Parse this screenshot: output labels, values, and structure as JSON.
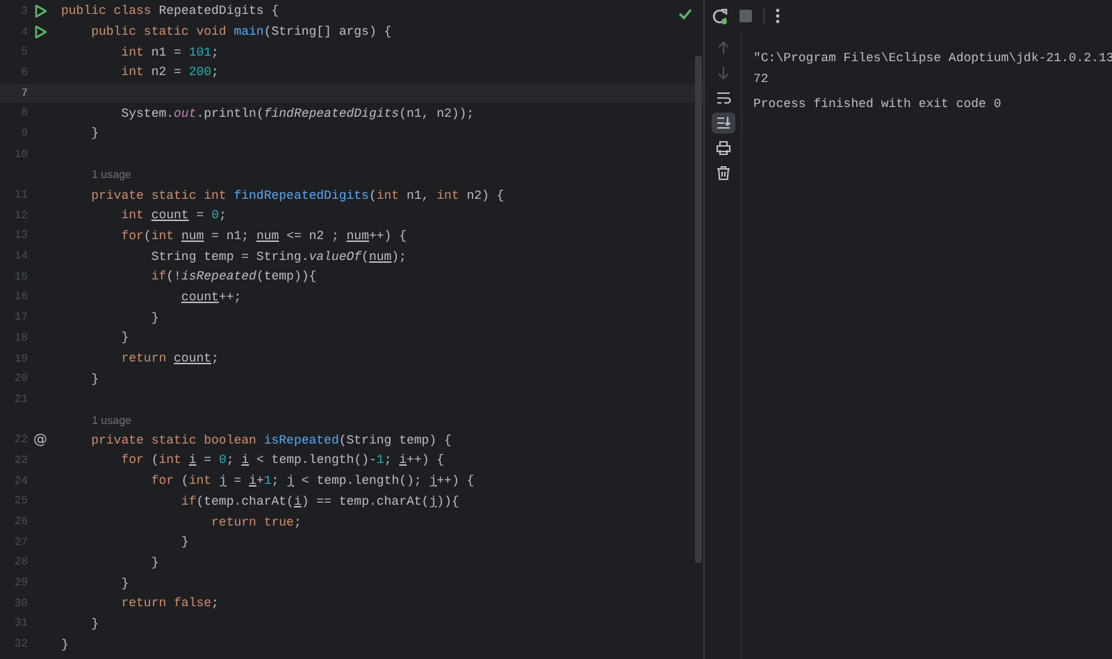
{
  "editor": {
    "lines": [
      {
        "kind": "code",
        "number": "3",
        "gutter": {
          "kind": "run"
        },
        "current": false,
        "tokens": [
          {
            "text": "public class ",
            "kind": "keyword"
          },
          {
            "text": "RepeatedDigits {",
            "kind": "plain"
          }
        ]
      },
      {
        "kind": "code",
        "number": "4",
        "gutter": {
          "kind": "run"
        },
        "current": false,
        "tokens": [
          {
            "text": "    public static void ",
            "kind": "keyword"
          },
          {
            "text": "main",
            "kind": "method"
          },
          {
            "text": "(String[] args) {",
            "kind": "plain"
          }
        ]
      },
      {
        "kind": "code",
        "number": "5",
        "current": false,
        "tokens": [
          {
            "text": "        int ",
            "kind": "keyword"
          },
          {
            "text": "n1 = ",
            "kind": "plain"
          },
          {
            "text": "101",
            "kind": "number"
          },
          {
            "text": ";",
            "kind": "plain"
          }
        ]
      },
      {
        "kind": "code",
        "number": "6",
        "current": false,
        "tokens": [
          {
            "text": "        int ",
            "kind": "keyword"
          },
          {
            "text": "n2 = ",
            "kind": "plain"
          },
          {
            "text": "200",
            "kind": "number"
          },
          {
            "text": ";",
            "kind": "plain"
          }
        ]
      },
      {
        "kind": "code",
        "number": "7",
        "current": true
      },
      {
        "kind": "code",
        "number": "8",
        "current": false,
        "tokens": [
          {
            "text": "        System.",
            "kind": "plain"
          },
          {
            "text": "out",
            "kind": "field"
          },
          {
            "text": ".println(",
            "kind": "plain"
          },
          {
            "text": "findRepeatedDigits",
            "kind": "static"
          },
          {
            "text": "(n1, n2));",
            "kind": "plain"
          }
        ]
      },
      {
        "kind": "code",
        "number": "9",
        "current": false,
        "tokens": [
          {
            "text": "    }",
            "kind": "plain"
          }
        ]
      },
      {
        "kind": "code",
        "number": "10",
        "current": false
      },
      {
        "kind": "hint",
        "text": "1 usage"
      },
      {
        "kind": "code",
        "number": "11",
        "current": false,
        "tokens": [
          {
            "text": "    private static int ",
            "kind": "keyword"
          },
          {
            "text": "findRepeatedDigits",
            "kind": "method"
          },
          {
            "text": "(",
            "kind": "plain"
          },
          {
            "text": "int ",
            "kind": "keyword"
          },
          {
            "text": "n1, ",
            "kind": "plain"
          },
          {
            "text": "int ",
            "kind": "keyword"
          },
          {
            "text": "n2) {",
            "kind": "plain"
          }
        ]
      },
      {
        "kind": "code",
        "number": "12",
        "current": false,
        "tokens": [
          {
            "text": "        int ",
            "kind": "keyword"
          },
          {
            "text": "count",
            "kind": "variable"
          },
          {
            "text": " = ",
            "kind": "plain"
          },
          {
            "text": "0",
            "kind": "number"
          },
          {
            "text": ";",
            "kind": "plain"
          }
        ]
      },
      {
        "kind": "code",
        "number": "13",
        "current": false,
        "tokens": [
          {
            "text": "        for",
            "kind": "keyword"
          },
          {
            "text": "(",
            "kind": "plain"
          },
          {
            "text": "int ",
            "kind": "keyword"
          },
          {
            "text": "num",
            "kind": "variable"
          },
          {
            "text": " = n1; ",
            "kind": "plain"
          },
          {
            "text": "num",
            "kind": "variable"
          },
          {
            "text": " <= n2 ; ",
            "kind": "plain"
          },
          {
            "text": "num",
            "kind": "variable"
          },
          {
            "text": "++) {",
            "kind": "plain"
          }
        ]
      },
      {
        "kind": "code",
        "number": "14",
        "current": false,
        "tokens": [
          {
            "text": "            String temp = String.",
            "kind": "plain"
          },
          {
            "text": "valueOf",
            "kind": "static"
          },
          {
            "text": "(",
            "kind": "plain"
          },
          {
            "text": "num",
            "kind": "variable"
          },
          {
            "text": ");",
            "kind": "plain"
          }
        ]
      },
      {
        "kind": "code",
        "number": "15",
        "current": false,
        "tokens": [
          {
            "text": "            if",
            "kind": "keyword"
          },
          {
            "text": "(!",
            "kind": "plain"
          },
          {
            "text": "isRepeated",
            "kind": "static"
          },
          {
            "text": "(temp)){",
            "kind": "plain"
          }
        ]
      },
      {
        "kind": "code",
        "number": "16",
        "current": false,
        "tokens": [
          {
            "text": "                count",
            "kind": "variable"
          },
          {
            "text": "++;",
            "kind": "plain"
          }
        ]
      },
      {
        "kind": "code",
        "number": "17",
        "current": false,
        "tokens": [
          {
            "text": "            }",
            "kind": "plain"
          }
        ]
      },
      {
        "kind": "code",
        "number": "18",
        "current": false,
        "tokens": [
          {
            "text": "        }",
            "kind": "plain"
          }
        ]
      },
      {
        "kind": "code",
        "number": "19",
        "current": false,
        "tokens": [
          {
            "text": "        return ",
            "kind": "keyword"
          },
          {
            "text": "count",
            "kind": "variable"
          },
          {
            "text": ";",
            "kind": "plain"
          }
        ]
      },
      {
        "kind": "code",
        "number": "20",
        "current": false,
        "tokens": [
          {
            "text": "    }",
            "kind": "plain"
          }
        ]
      },
      {
        "kind": "code",
        "number": "21",
        "current": false
      },
      {
        "kind": "hint",
        "text": "1 usage"
      },
      {
        "kind": "code",
        "number": "22",
        "gutter": {
          "kind": "override",
          "symbol": "@"
        },
        "current": false,
        "tokens": [
          {
            "text": "    private static boolean ",
            "kind": "keyword"
          },
          {
            "text": "isRepeated",
            "kind": "method"
          },
          {
            "text": "(String temp) {",
            "kind": "plain"
          }
        ]
      },
      {
        "kind": "code",
        "number": "23",
        "current": false,
        "tokens": [
          {
            "text": "        for ",
            "kind": "keyword"
          },
          {
            "text": "(",
            "kind": "plain"
          },
          {
            "text": "int ",
            "kind": "keyword"
          },
          {
            "text": "i",
            "kind": "variable"
          },
          {
            "text": " = ",
            "kind": "plain"
          },
          {
            "text": "0",
            "kind": "number"
          },
          {
            "text": "; ",
            "kind": "plain"
          },
          {
            "text": "i",
            "kind": "variable"
          },
          {
            "text": " < temp.length()-",
            "kind": "plain"
          },
          {
            "text": "1",
            "kind": "number"
          },
          {
            "text": "; ",
            "kind": "plain"
          },
          {
            "text": "i",
            "kind": "variable"
          },
          {
            "text": "++) {",
            "kind": "plain"
          }
        ]
      },
      {
        "kind": "code",
        "number": "24",
        "current": false,
        "tokens": [
          {
            "text": "            for ",
            "kind": "keyword"
          },
          {
            "text": "(",
            "kind": "plain"
          },
          {
            "text": "int ",
            "kind": "keyword"
          },
          {
            "text": "j",
            "kind": "variable"
          },
          {
            "text": " = ",
            "kind": "plain"
          },
          {
            "text": "i",
            "kind": "variable"
          },
          {
            "text": "+",
            "kind": "plain"
          },
          {
            "text": "1",
            "kind": "number"
          },
          {
            "text": "; ",
            "kind": "plain"
          },
          {
            "text": "j",
            "kind": "variable"
          },
          {
            "text": " < temp.length(); ",
            "kind": "plain"
          },
          {
            "text": "j",
            "kind": "variable"
          },
          {
            "text": "++) {",
            "kind": "plain"
          }
        ]
      },
      {
        "kind": "code",
        "number": "25",
        "current": false,
        "tokens": [
          {
            "text": "                if",
            "kind": "keyword"
          },
          {
            "text": "(temp.charAt(",
            "kind": "plain"
          },
          {
            "text": "i",
            "kind": "variable"
          },
          {
            "text": ") == temp.charAt(",
            "kind": "plain"
          },
          {
            "text": "j",
            "kind": "variable"
          },
          {
            "text": ")){",
            "kind": "plain"
          }
        ]
      },
      {
        "kind": "code",
        "number": "26",
        "current": false,
        "tokens": [
          {
            "text": "                    return true",
            "kind": "keyword"
          },
          {
            "text": ";",
            "kind": "plain"
          }
        ]
      },
      {
        "kind": "code",
        "number": "27",
        "current": false,
        "tokens": [
          {
            "text": "                }",
            "kind": "plain"
          }
        ]
      },
      {
        "kind": "code",
        "number": "28",
        "current": false,
        "tokens": [
          {
            "text": "            }",
            "kind": "plain"
          }
        ]
      },
      {
        "kind": "code",
        "number": "29",
        "current": false,
        "tokens": [
          {
            "text": "        }",
            "kind": "plain"
          }
        ]
      },
      {
        "kind": "code",
        "number": "30",
        "current": false,
        "tokens": [
          {
            "text": "        return false",
            "kind": "keyword"
          },
          {
            "text": ";",
            "kind": "plain"
          }
        ]
      },
      {
        "kind": "code",
        "number": "31",
        "current": false,
        "tokens": [
          {
            "text": "    }",
            "kind": "plain"
          }
        ]
      },
      {
        "kind": "code",
        "number": "32",
        "current": false,
        "tokens": [
          {
            "text": "}",
            "kind": "plain"
          }
        ]
      }
    ]
  },
  "run_panel": {
    "side_tools": [
      {
        "kind": "up",
        "disabled": true,
        "selected": false
      },
      {
        "kind": "down",
        "disabled": true,
        "selected": false
      },
      {
        "kind": "wrap",
        "disabled": false,
        "selected": false
      },
      {
        "kind": "scroll-end",
        "disabled": false,
        "selected": true
      },
      {
        "kind": "print",
        "disabled": false,
        "selected": false
      },
      {
        "kind": "trash",
        "disabled": false,
        "selected": false
      }
    ],
    "console_lines": [
      {
        "kind": "output",
        "text": "\"C:\\Program Files\\Eclipse Adoptium\\jdk-21.0.2.13"
      },
      {
        "kind": "output",
        "text": "72"
      },
      {
        "kind": "status",
        "text": "Process finished with exit code 0"
      }
    ]
  }
}
